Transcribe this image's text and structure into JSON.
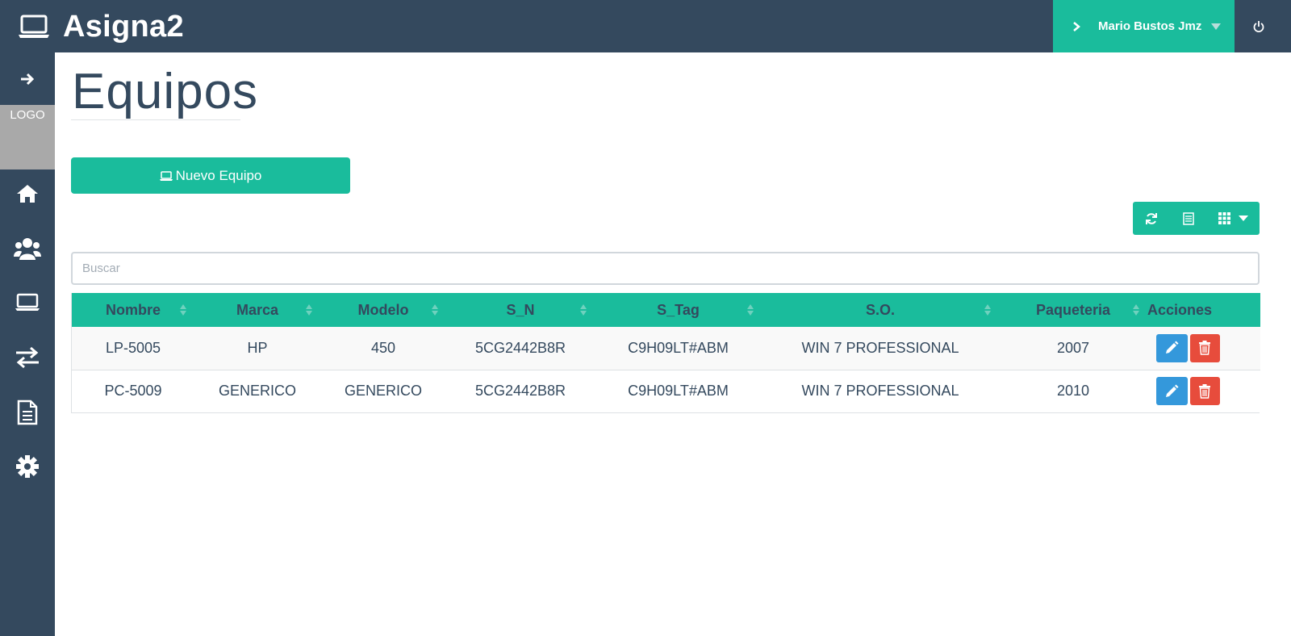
{
  "app": {
    "title": "Asigna2",
    "logo_text": "LOGO"
  },
  "header": {
    "user_name": "Mario Bustos Jmz",
    "icons": [
      "laptop-icon",
      "chevron-right-icon",
      "caret-down-icon",
      "power-icon"
    ]
  },
  "sidebar": {
    "items": [
      {
        "icon": "arrow-right-icon"
      },
      {
        "icon": "home-icon"
      },
      {
        "icon": "users-icon"
      },
      {
        "icon": "laptop-icon"
      },
      {
        "icon": "exchange-icon"
      },
      {
        "icon": "document-icon"
      },
      {
        "icon": "gear-icon"
      }
    ]
  },
  "page": {
    "title": "Equipos",
    "new_button_label": "Nuevo Equipo"
  },
  "toolbar": {
    "icons": [
      "refresh-icon",
      "list-icon",
      "grid-icon",
      "caret-down-icon"
    ]
  },
  "search": {
    "placeholder": "Buscar",
    "value": ""
  },
  "table": {
    "headers": [
      "Nombre",
      "Marca",
      "Modelo",
      "S_N",
      "S_Tag",
      "S.O.",
      "Paqueteria",
      "Acciones"
    ],
    "rows": [
      [
        "LP-5005",
        "HP",
        "450",
        "5CG2442B8R",
        "C9H09LT#ABM",
        "WIN 7 PROFESSIONAL",
        "2007"
      ],
      [
        "PC-5009",
        "GENERICO",
        "GENERICO",
        "5CG2442B8R",
        "C9H09LT#ABM",
        "WIN 7 PROFESSIONAL",
        "2010"
      ]
    ]
  },
  "colors": {
    "navy": "#34495e",
    "accent": "#1abc9c",
    "edit": "#3498db",
    "delete": "#e74c3c",
    "logo_bg": "#a9a9a9"
  }
}
